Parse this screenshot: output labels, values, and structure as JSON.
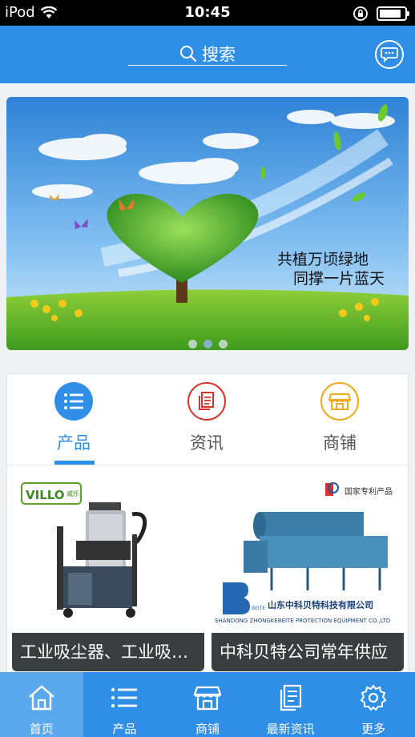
{
  "status_bar": {
    "carrier": "iPod",
    "time": "10:45",
    "battery_level": 0.85
  },
  "header": {
    "search_label": "搜索",
    "search_icon": "search-icon",
    "message_icon": "message-icon"
  },
  "banner": {
    "slogan_line1": "共植万顷绿地",
    "slogan_line2": "同撑一片蓝天",
    "slide_count": 3,
    "active_slide": 1
  },
  "category_tabs": [
    {
      "label": "产品",
      "icon": "list-icon",
      "color": "#2f8ee6",
      "active": true
    },
    {
      "label": "资讯",
      "icon": "document-icon",
      "color": "#d9342b",
      "active": false
    },
    {
      "label": "商铺",
      "icon": "store-icon",
      "color": "#f0a81c",
      "active": false
    }
  ],
  "products": [
    {
      "title": "工业吸尘器、工业吸尘器",
      "brand_logo": "VILLO",
      "logo_sub": "威乐"
    },
    {
      "title": "中科贝特公司常年供应",
      "patent_label": "国家专利产品",
      "company_cn": "山东中科贝特科技有限公司",
      "company_en": "SHANDONG ZHONGKEBEITE PROTECTION EQUIPMENT CO.,LTD",
      "logo_text": "BEITE"
    }
  ],
  "bottom_nav": [
    {
      "label": "首页",
      "icon": "home-icon",
      "active": true
    },
    {
      "label": "产品",
      "icon": "list-icon",
      "active": false
    },
    {
      "label": "商铺",
      "icon": "store-icon",
      "active": false
    },
    {
      "label": "最新资讯",
      "icon": "news-icon",
      "active": false
    },
    {
      "label": "更多",
      "icon": "gear-icon",
      "active": false
    }
  ],
  "colors": {
    "primary": "#2f8ee6",
    "nav_active": "#5aa9ee",
    "caption_bg": "#3a3d40"
  }
}
